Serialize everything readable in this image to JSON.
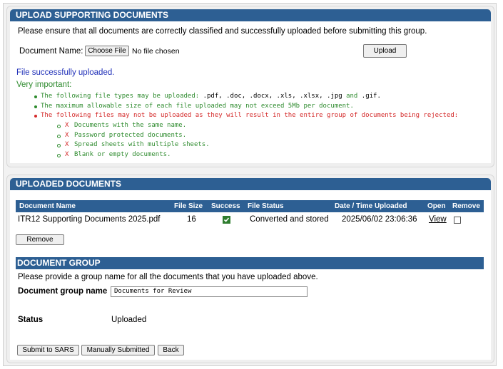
{
  "upload": {
    "header": "UPLOAD SUPPORTING DOCUMENTS",
    "instruction": "Please ensure that all documents are correctly classified and successfully uploaded before submitting this group.",
    "doc_name_label": "Document Name:",
    "choose_file_label": "Choose File",
    "no_file_text": "No file chosen",
    "upload_button": "Upload",
    "success_message": "File successfully uploaded.",
    "important_label": "Very important:",
    "rule1_prefix": "The following file types may be uploaded:",
    "rule1_types": ".pdf, .doc, .docx, .xls, .xlsx, .jpg",
    "rule1_and": "and",
    "rule1_last": ".gif.",
    "rule2": "The maximum allowable size of each file uploaded may not exceed 5Mb per document.",
    "rule3": "The following files may not be uploaded as they will result in the entire group of documents being rejected:",
    "reject_items": [
      {
        "mark": "X",
        "text": "Documents with the same name."
      },
      {
        "mark": "X",
        "text": "Password protected documents."
      },
      {
        "mark": "X",
        "text": "Spread sheets with multiple sheets."
      },
      {
        "mark": "X",
        "text": "Blank or empty documents."
      }
    ]
  },
  "uploaded": {
    "header": "UPLOADED DOCUMENTS",
    "columns": [
      "Document Name",
      "File Size",
      "Success",
      "File Status",
      "Date / Time Uploaded",
      "Open",
      "Remove"
    ],
    "rows": [
      {
        "name": "ITR12 Supporting Documents 2025.pdf",
        "size": "16",
        "success": true,
        "status": "Converted and stored",
        "datetime": "2025/06/02 23:06:36",
        "open": "View",
        "remove": false
      }
    ],
    "remove_button": "Remove"
  },
  "group": {
    "header": "DOCUMENT GROUP",
    "instruction": "Please provide a group name for all the documents that you have uploaded above.",
    "name_label": "Document group name",
    "name_value": "Documents for Review",
    "status_label": "Status",
    "status_value": "Uploaded"
  },
  "actions": {
    "submit": "Submit to SARS",
    "manual": "Manually Submitted",
    "back": "Back"
  },
  "colors": {
    "header_blue": "#2d5f93",
    "rule_green": "#2e8b2e",
    "rule_red": "#d42a2a",
    "success_blue": "#1f2fb8"
  }
}
